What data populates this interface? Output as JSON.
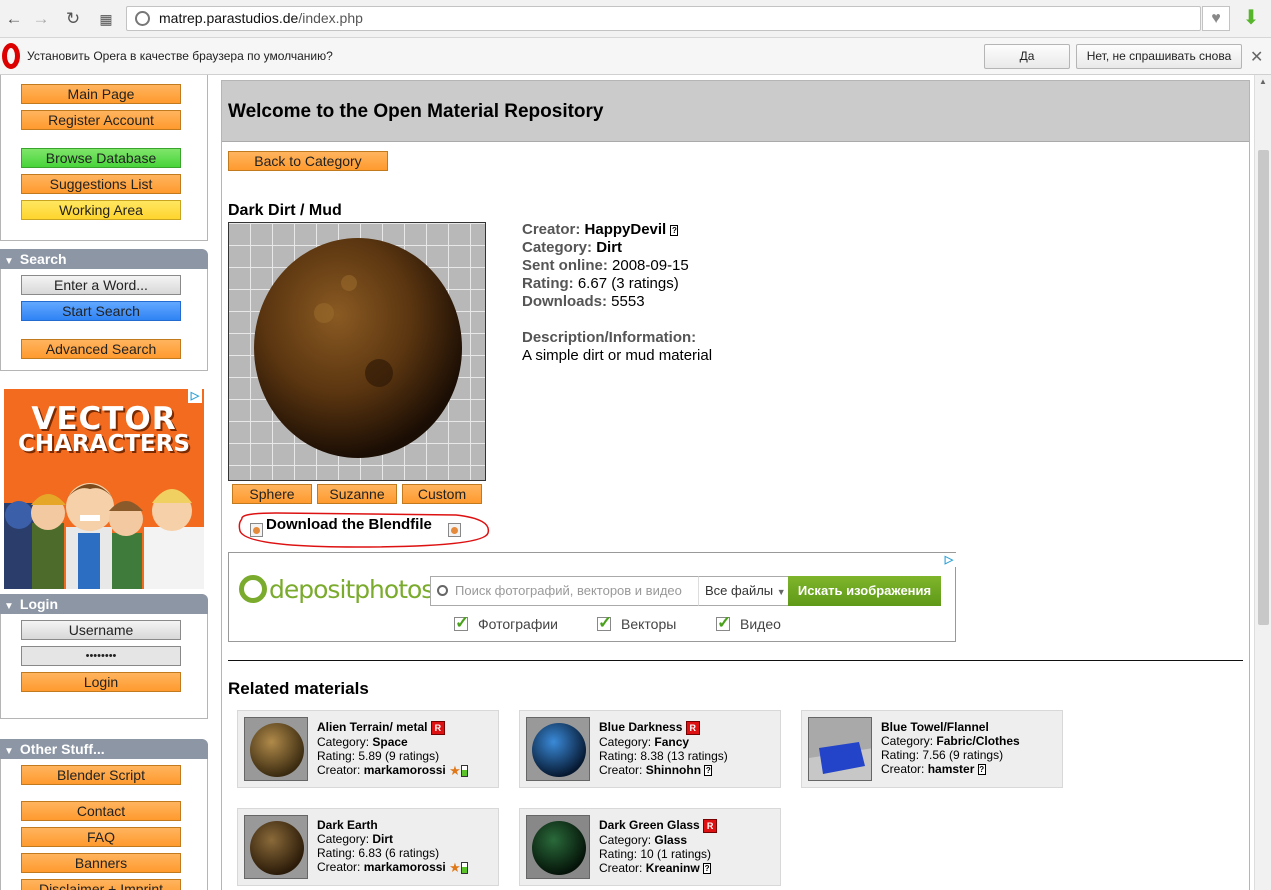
{
  "browser": {
    "url_host": "matrep.parastudios.de",
    "url_path": "/index.php"
  },
  "infobar": {
    "message": "Установить Opera в качестве браузера по умолчанию?",
    "yes": "Да",
    "no": "Нет, не спрашивать снова"
  },
  "sidebar": {
    "nav": [
      "Main Page",
      "Register Account",
      "Browse Database",
      "Suggestions List",
      "Working Area"
    ],
    "search": {
      "title": "Search",
      "input": "Enter a Word...",
      "start": "Start Search",
      "advanced": "Advanced Search"
    },
    "ad": {
      "line1": "VECTOR",
      "line2": "CHARACTERS"
    },
    "login": {
      "title": "Login",
      "username": "Username",
      "password": "••••••••",
      "button": "Login"
    },
    "other": {
      "title": "Other Stuff...",
      "items": [
        "Blender Script",
        "Contact",
        "FAQ",
        "Banners",
        "Disclaimer + Imprint"
      ]
    }
  },
  "main": {
    "heading": "Welcome to the Open Material Repository",
    "back": "Back to Category",
    "material": {
      "title": "Dark Dirt / Mud",
      "creator_label": "Creator:",
      "creator": "HappyDevil",
      "category_label": "Category:",
      "category": "Dirt",
      "sent_label": "Sent online:",
      "sent": "2008-09-15",
      "rating_label": "Rating:",
      "rating": "6.67 (3 ratings)",
      "downloads_label": "Downloads:",
      "downloads": "5553",
      "desc_label": "Description/Information:",
      "desc": "A simple dirt or mud material"
    },
    "preview_buttons": [
      "Sphere",
      "Suzanne",
      "Custom"
    ],
    "download": "Download the Blendfile",
    "ad_dp": {
      "logo": "depositphotos",
      "placeholder": "Поиск фотографий, векторов и видео",
      "select": "Все файлы",
      "go": "Искать изображения",
      "checks": [
        "Фотографии",
        "Векторы",
        "Видео"
      ]
    },
    "related_title": "Related materials",
    "related": [
      {
        "name": "Alien Terrain/ metal",
        "cat_label": "Category:",
        "cat": "Space",
        "rating": "Rating: 5.89 (9 ratings)",
        "creator_label": "Creator:",
        "creator": "markamorossi"
      },
      {
        "name": "Blue Darkness",
        "cat_label": "Category:",
        "cat": "Fancy",
        "rating": "Rating: 8.38 (13 ratings)",
        "creator_label": "Creator:",
        "creator": "Shinnohn"
      },
      {
        "name": "Blue Towel/Flannel",
        "cat_label": "Category:",
        "cat": "Fabric/Clothes",
        "rating": "Rating: 7.56 (9 ratings)",
        "creator_label": "Creator:",
        "creator": "hamster"
      },
      {
        "name": "Dark Earth",
        "cat_label": "Category:",
        "cat": "Dirt",
        "rating": "Rating: 6.83 (6 ratings)",
        "creator_label": "Creator:",
        "creator": "markamorossi"
      },
      {
        "name": "Dark Green Glass",
        "cat_label": "Category:",
        "cat": "Glass",
        "rating": "Rating: 10 (1 ratings)",
        "creator_label": "Creator:",
        "creator": "Kreaninw"
      }
    ]
  }
}
